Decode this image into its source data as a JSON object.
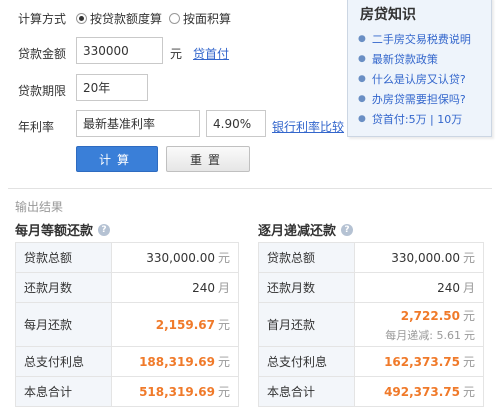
{
  "form": {
    "calc_method_label": "计算方式",
    "radio_loan_amount": "按贷款额度算",
    "radio_area": "按面积算",
    "loan_amount_label": "贷款金额",
    "loan_amount_value": "330000",
    "loan_amount_unit": "元",
    "down_payment_link": "贷首付",
    "term_label": "贷款期限",
    "term_value": "20年",
    "rate_label": "年利率",
    "rate_type_value": "最新基准利率",
    "rate_value": "4.90%",
    "rate_compare_link": "银行利率比较",
    "calc_button": "计算",
    "reset_button": "重置"
  },
  "knowledge": {
    "title": "房贷知识",
    "items": [
      "二手房交易税费说明",
      "最新贷款政策",
      "什么是认房又认贷?",
      "办房贷需要担保吗?",
      "贷首付:5万 | 10万"
    ]
  },
  "result": {
    "section_title": "输出结果",
    "equal_payment": {
      "title": "每月等额还款",
      "rows": [
        {
          "key": "贷款总额",
          "value": "330,000.00",
          "unit": "元"
        },
        {
          "key": "还款月数",
          "value": "240",
          "unit": "月"
        },
        {
          "key": "每月还款",
          "value": "2,159.67",
          "unit": "元"
        },
        {
          "key": "总支付利息",
          "value": "188,319.69",
          "unit": "元"
        },
        {
          "key": "本息合计",
          "value": "518,319.69",
          "unit": "元"
        }
      ]
    },
    "decreasing_payment": {
      "title": "逐月递减还款",
      "rows": [
        {
          "key": "贷款总额",
          "value": "330,000.00",
          "unit": "元"
        },
        {
          "key": "还款月数",
          "value": "240",
          "unit": "月"
        },
        {
          "key": "首月还款",
          "value": "2,722.50",
          "unit": "元",
          "sub_label": "每月递减:",
          "sub_value": "5.61",
          "sub_unit": "元"
        },
        {
          "key": "总支付利息",
          "value": "162,373.75",
          "unit": "元"
        },
        {
          "key": "本息合计",
          "value": "492,373.75",
          "unit": "元"
        }
      ]
    }
  },
  "colors": {
    "accent_blue": "#3a7fd8",
    "highlight_orange": "#f07a2a",
    "link_blue": "#3366cc"
  }
}
